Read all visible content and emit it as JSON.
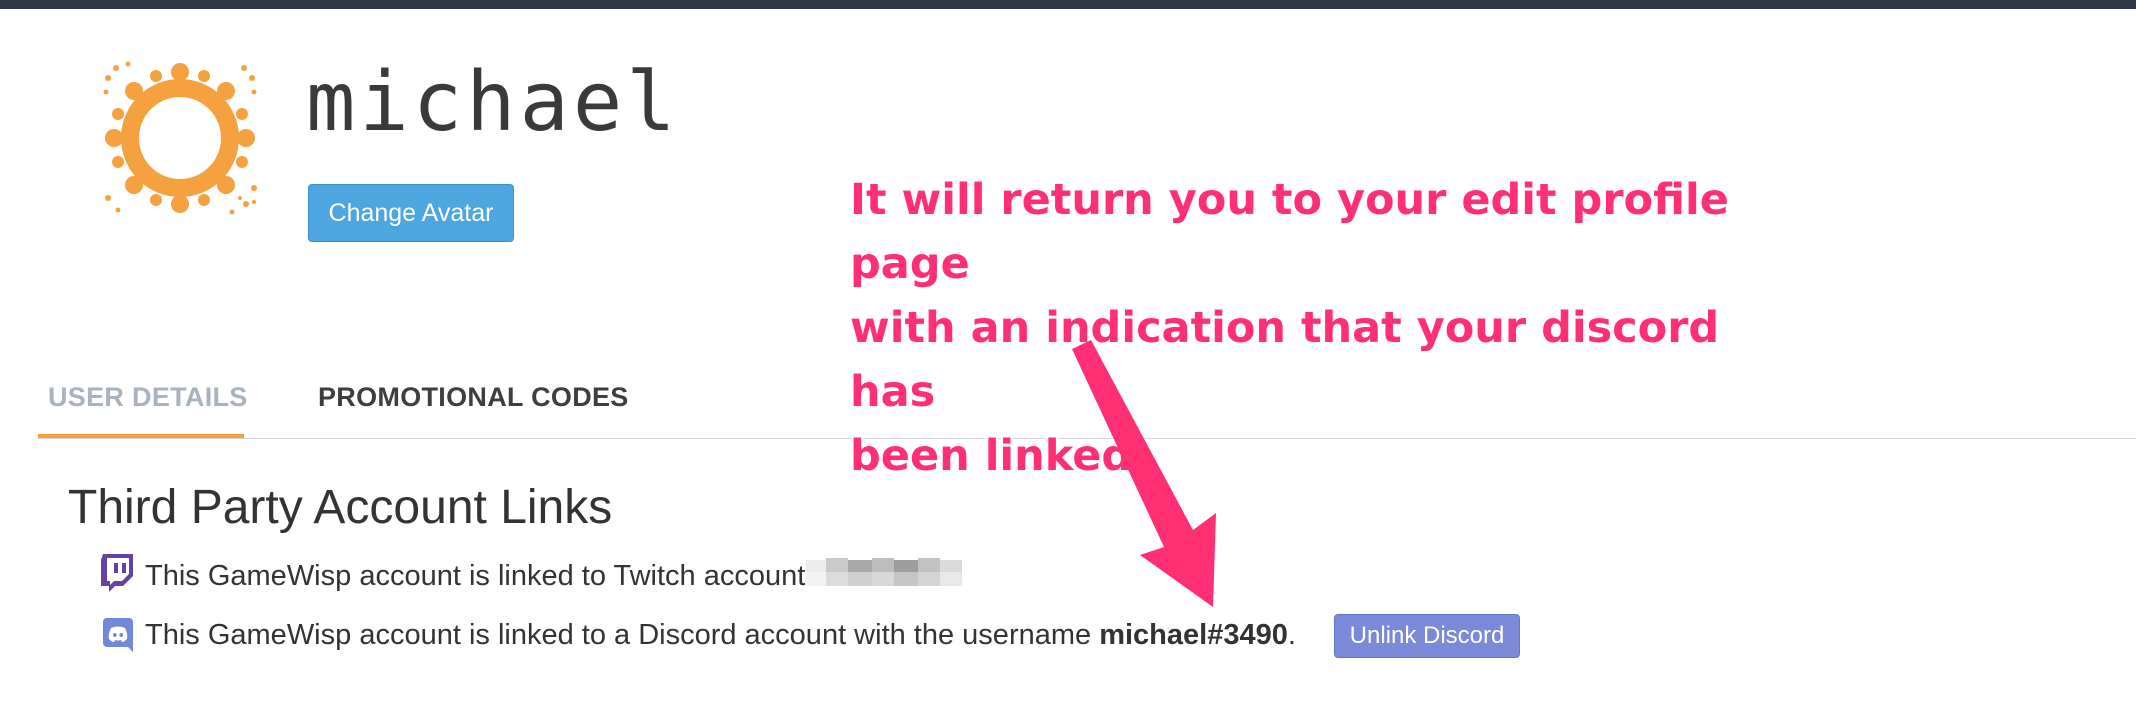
{
  "profile": {
    "username": "michael",
    "change_avatar_label": "Change Avatar"
  },
  "tabs": [
    {
      "label": "USER DETAILS",
      "active": true
    },
    {
      "label": "PROMOTIONAL CODES",
      "active": false
    }
  ],
  "third_party": {
    "title": "Third Party Account Links",
    "twitch": {
      "text": "This GameWisp account is linked to Twitch account",
      "icon": "twitch-icon"
    },
    "discord": {
      "text_before": "This GameWisp account is linked to a Discord account with the username ",
      "username": "michael#3490",
      "text_after": ".",
      "unlink_label": "Unlink Discord",
      "icon": "discord-icon"
    }
  },
  "annotation": {
    "line1": "It will return you to your edit profile page",
    "line2": "with an indication that your discord has",
    "line3": "been linked."
  },
  "colors": {
    "topbar": "#2f3646",
    "accent_orange": "#f5a140",
    "button_blue": "#4ea6e0",
    "discord_button": "#7a89d8",
    "annotation_pink": "#ff2f73",
    "twitch_purple": "#6441a5",
    "discord_blurple": "#7289da"
  }
}
